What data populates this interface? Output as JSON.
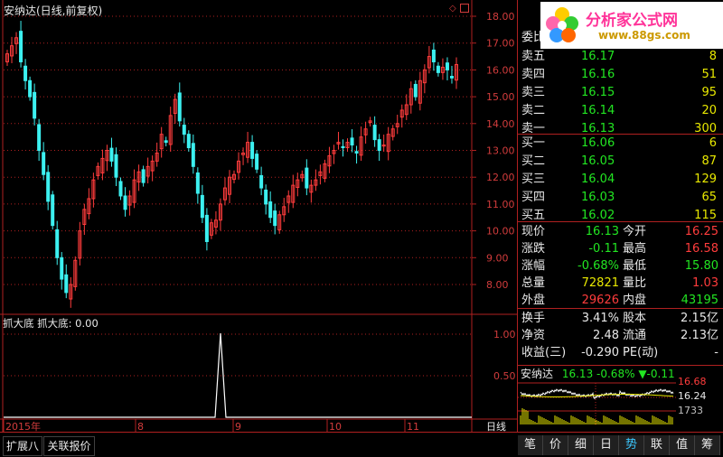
{
  "chart_header": {
    "title": "安纳达(日线,前复权)"
  },
  "price_axis": [
    "18.00",
    "17.00",
    "16.00",
    "15.00",
    "14.00",
    "13.00",
    "12.00",
    "11.00",
    "10.00",
    "9.00",
    "8.00"
  ],
  "indicator": {
    "title": "抓大底  抓大底: 0.00",
    "axis": [
      "1.00",
      "0.50"
    ]
  },
  "date_axis": {
    "labels": [
      "2015年",
      "8",
      "9",
      "10",
      "11"
    ],
    "period": "日线"
  },
  "bottom_tabs": [
    "扩展八",
    "关联报价"
  ],
  "logo": {
    "brand": "分析家公式网",
    "url": "www.88gs.com"
  },
  "order_book": {
    "header": "委比",
    "asks": [
      {
        "label": "卖五",
        "price": "16.17",
        "vol": "8"
      },
      {
        "label": "卖四",
        "price": "16.16",
        "vol": "51"
      },
      {
        "label": "卖三",
        "price": "16.15",
        "vol": "95"
      },
      {
        "label": "卖二",
        "price": "16.14",
        "vol": "20"
      },
      {
        "label": "卖一",
        "price": "16.13",
        "vol": "300"
      }
    ],
    "bids": [
      {
        "label": "买一",
        "price": "16.06",
        "vol": "6"
      },
      {
        "label": "买二",
        "price": "16.05",
        "vol": "87"
      },
      {
        "label": "买三",
        "price": "16.04",
        "vol": "129"
      },
      {
        "label": "买四",
        "price": "16.03",
        "vol": "65"
      },
      {
        "label": "买五",
        "price": "16.02",
        "vol": "115"
      }
    ]
  },
  "quote": [
    {
      "k1": "现价",
      "v1": "16.13",
      "c1": "green",
      "k2": "今开",
      "v2": "16.25",
      "c2": "red"
    },
    {
      "k1": "涨跌",
      "v1": "-0.11",
      "c1": "green",
      "k2": "最高",
      "v2": "16.58",
      "c2": "red"
    },
    {
      "k1": "涨幅",
      "v1": "-0.68%",
      "c1": "green",
      "k2": "最低",
      "v2": "15.80",
      "c2": "green"
    },
    {
      "k1": "总量",
      "v1": "72821",
      "c1": "yellow",
      "k2": "量比",
      "v2": "1.03",
      "c2": "red"
    },
    {
      "k1": "外盘",
      "v1": "29626",
      "c1": "red",
      "k2": "内盘",
      "v2": "43195",
      "c2": "green"
    }
  ],
  "finance": [
    {
      "k1": "换手",
      "v1": "3.41%",
      "k2": "股本",
      "v2": "2.15亿"
    },
    {
      "k1": "净资",
      "v1": "2.48",
      "k2": "流通",
      "v2": "2.13亿"
    },
    {
      "k1": "收益(三)",
      "v1": "-0.290",
      "k2": "PE(动)",
      "v2": "-"
    }
  ],
  "mini": {
    "name": "安纳达",
    "price": "16.13",
    "pct": "-0.68%",
    "chg": "▼-0.11",
    "hi": "16.68",
    "mid": "16.24",
    "vol": "1733"
  },
  "right_tabs": [
    "笔",
    "价",
    "细",
    "日",
    "势",
    "联",
    "值",
    "筹"
  ],
  "colors": {
    "up": "#ff3c3c",
    "down": "#3cf0f0",
    "grid": "#b02020",
    "text": "#e8e8e8"
  }
}
